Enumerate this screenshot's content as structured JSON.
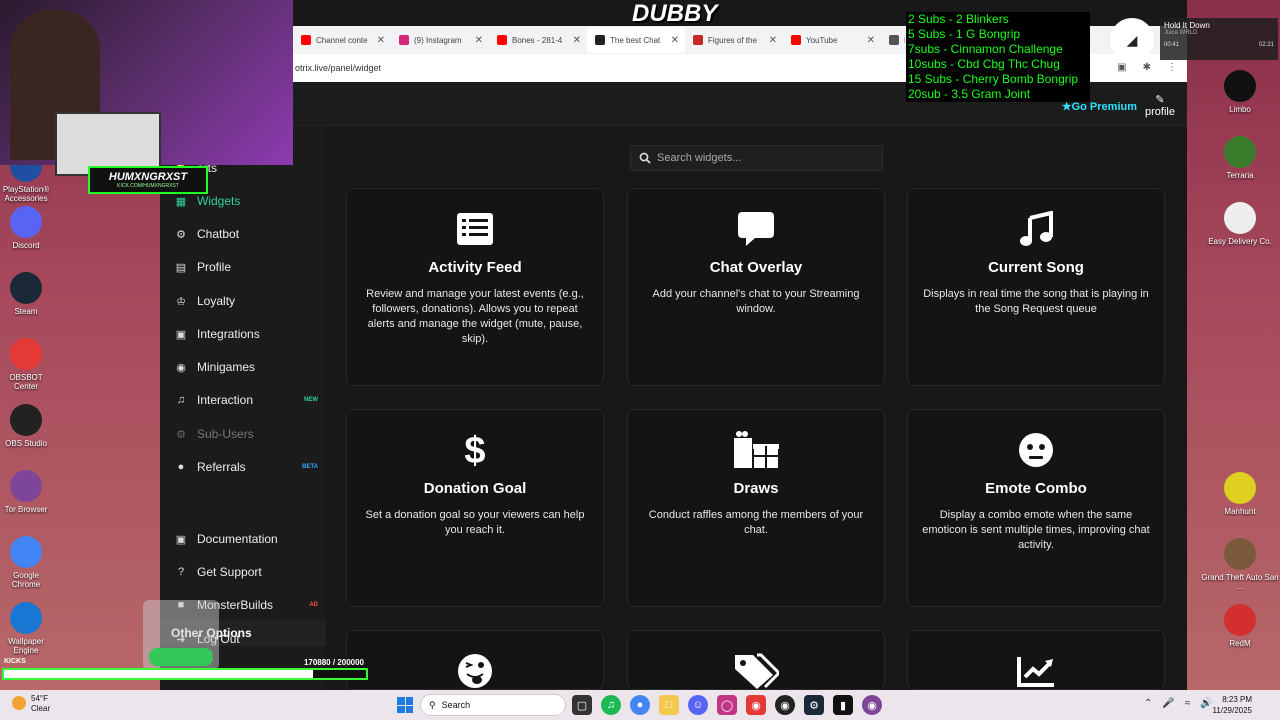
{
  "browser": {
    "tabs": [
      {
        "label": "Channel conte",
        "color": "#ff0000"
      },
      {
        "label": "(9) Instagram",
        "color": "#d62976"
      },
      {
        "label": "Bones - 281-4",
        "color": "#ff0000"
      },
      {
        "label": "The best Chat",
        "color": "#222222",
        "active": true
      },
      {
        "label": "Figures of the",
        "color": "#c62828"
      },
      {
        "label": "YouTube",
        "color": "#ff0000"
      },
      {
        "label": "N",
        "color": "#555555"
      }
    ],
    "url": "otrix.live/panel/widget"
  },
  "header": {
    "premium": "Go Premium",
    "profile": "profile"
  },
  "sidebar": {
    "items": [
      {
        "label": "erts",
        "icon": "bell-icon"
      },
      {
        "label": "Widgets",
        "icon": "widgets-icon",
        "active": true
      },
      {
        "label": "Chatbot",
        "icon": "robot-icon"
      },
      {
        "label": "Profile",
        "icon": "id-card-icon"
      },
      {
        "label": "Loyalty",
        "icon": "trophy-icon"
      },
      {
        "label": "Integrations",
        "icon": "plug-icon"
      },
      {
        "label": "Minigames",
        "icon": "gamepad-icon"
      },
      {
        "label": "Interaction",
        "icon": "music-icon",
        "badge": "NEW"
      },
      {
        "label": "Sub-Users",
        "icon": "robot-icon",
        "muted": true
      },
      {
        "label": "Referrals",
        "icon": "users-icon",
        "badge": "BETA"
      }
    ],
    "other_heading": "Other Options",
    "other_items": [
      {
        "label": "Documentation",
        "icon": "book-icon"
      },
      {
        "label": "Get Support",
        "icon": "question-icon"
      },
      {
        "label": "MonsterBuilds",
        "icon": "monster-icon",
        "badge": "AD"
      },
      {
        "label": "Log Out",
        "icon": "logout-icon"
      }
    ],
    "colors": {
      "active": "#33d1a2",
      "new_badge": "#33d1a2",
      "beta_badge": "#2ea8ff",
      "ad_badge": "#ff4d4d"
    }
  },
  "search": {
    "placeholder": "Search widgets..."
  },
  "widgets": [
    {
      "title": "Activity Feed",
      "desc": "Review and manage your latest events (e.g., followers, donations). Allows you to repeat alerts and manage the widget (mute, pause, skip).",
      "icon": "list-icon"
    },
    {
      "title": "Chat Overlay",
      "desc": "Add your channel's chat to your Streaming window.",
      "icon": "chat-bubble-icon"
    },
    {
      "title": "Current Song",
      "desc": "Displays in real time the song that is playing in the Song Request queue",
      "icon": "music-note-icon"
    },
    {
      "title": "Donation Goal",
      "desc": "Set a donation goal so your viewers can help you reach it.",
      "icon": "dollar-icon"
    },
    {
      "title": "Draws",
      "desc": "Conduct raffles among the members of your chat.",
      "icon": "gifts-icon"
    },
    {
      "title": "Emote Combo",
      "desc": "Display a combo emote when the same emoticon is sent multiple times, improving chat activity.",
      "icon": "emote-face-icon"
    },
    {
      "title": "",
      "desc": "",
      "icon": "tongue-face-icon"
    },
    {
      "title": "",
      "desc": "",
      "icon": "tags-icon"
    },
    {
      "title": "",
      "desc": "",
      "icon": "chart-line-icon"
    }
  ],
  "stream": {
    "title": "DUBBY",
    "handle": "HUMXNGRXST",
    "handle_sub": "KICK.COM/HUMXNGRXST",
    "subgoals": [
      "2 Subs - 2 Blinkers",
      "5 Subs - 1 G Bongrip",
      "7subs - Cinnamon Challenge",
      "10subs - Cbd Cbg Thc Chug",
      "15 Subs - Cherry Bomb Bongrip",
      "20sub - 3.5 Gram Joint"
    ],
    "music": {
      "song": "Hold It Down",
      "artist": "Juice WRLD",
      "elapsed": "00:41",
      "total": "02:21"
    },
    "kicks_label": "KICKS",
    "kicks_count": "170880  / 200000",
    "kicks_progress": 0.854
  },
  "desktop": {
    "left_icons": [
      {
        "label": "PlayStation® Accessories",
        "icon": "playstation-icon",
        "color": "#1f4fa0"
      },
      {
        "label": "Discord",
        "icon": "discord-icon",
        "color": "#5865f2"
      },
      {
        "label": "Steam",
        "icon": "steam-icon",
        "color": "#1b2838"
      },
      {
        "label": "OBSBOT Center",
        "icon": "obsbot-icon",
        "color": "#e53935"
      },
      {
        "label": "OBS Studio",
        "icon": "obs-icon",
        "color": "#222222"
      },
      {
        "label": "Tor Browser",
        "icon": "tor-icon",
        "color": "#7d4698"
      },
      {
        "label": "Google Chrome",
        "icon": "chrome-icon",
        "color": "#4285f4"
      },
      {
        "label": "Wallpaper Engine",
        "icon": "wallpaper-engine-icon",
        "color": "#1976d2"
      }
    ],
    "right_icons": [
      {
        "label": "Limbo",
        "icon": "limbo-icon",
        "color": "#111111"
      },
      {
        "label": "Terraria",
        "icon": "terraria-icon",
        "color": "#3a7d2c"
      },
      {
        "label": "Easy Delivery Co.",
        "icon": "easy-delivery-icon",
        "color": "#eeeeee"
      },
      {
        "label": "Manhunt",
        "icon": "manhunt-icon",
        "color": "#e0d020"
      },
      {
        "label": "Grand Theft Auto San ...",
        "icon": "gta-icon",
        "color": "#7a5a3a"
      },
      {
        "label": "RedM",
        "icon": "redm-icon",
        "color": "#d32f2f"
      }
    ]
  },
  "taskbar": {
    "weather_temp": "54°F",
    "weather_cond": "Clear",
    "search": "Search",
    "time": "8:23 PM",
    "date": "11/29/2025"
  }
}
